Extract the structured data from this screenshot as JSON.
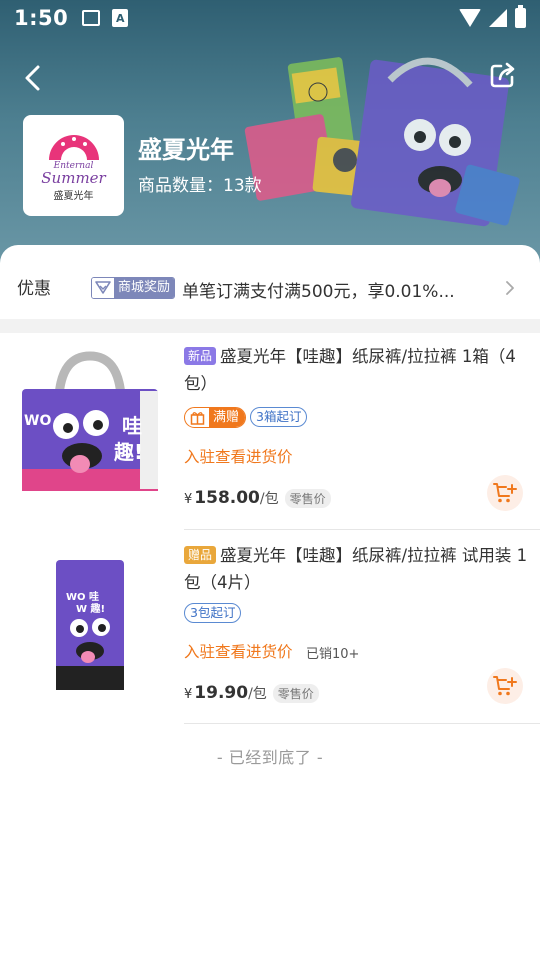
{
  "status_bar": {
    "time": "1:50",
    "sim_icon_text": "A"
  },
  "header": {
    "shop_name": "盛夏光年",
    "product_count": "商品数量：13款",
    "logo": {
      "line1": "Enternal",
      "line2": "Summer",
      "line3": "盛夏光年"
    }
  },
  "promo": {
    "label": "优惠",
    "badge": "商城奖励",
    "text": "单笔订满支付满500元，享0.01%..."
  },
  "products": [
    {
      "tag": "新品",
      "title": "盛夏光年【哇趣】纸尿裤/拉拉裤 1箱（4包）",
      "gift_chip": "满赠",
      "min_order": "3箱起订",
      "enter_text": "入驻查看进货价",
      "sold": "",
      "currency": "¥",
      "price": "158.00",
      "unit": "/包",
      "retail_label": "零售价"
    },
    {
      "tag": "赠品",
      "title": "盛夏光年【哇趣】纸尿裤/拉拉裤 试用装 1包（4片）",
      "gift_chip": "",
      "min_order": "3包起订",
      "enter_text": "入驻查看进货价",
      "sold": "已销10+",
      "currency": "¥",
      "price": "19.90",
      "unit": "/包",
      "retail_label": "零售价"
    }
  ],
  "footer_text": "- 已经到底了 -",
  "colors": {
    "accent": "#f0781d",
    "hero_bg": "#4d7f90",
    "badge": "#7d87b9",
    "new_tag": "#8b79e6",
    "gift_tag": "#e9a73b"
  }
}
